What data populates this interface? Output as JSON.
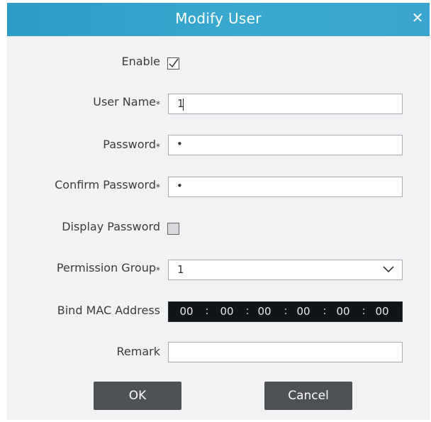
{
  "dialog": {
    "title": "Modify User",
    "close_symbol": "✕",
    "close_icon": "close-icon"
  },
  "form": {
    "enable": {
      "label": "Enable",
      "checked": true
    },
    "user_name": {
      "label": "User Name",
      "required_mark": "*",
      "value": "1"
    },
    "password": {
      "label": "Password",
      "required_mark": "*",
      "value": "•"
    },
    "confirm_password": {
      "label": "Confirm Password",
      "required_mark": "*",
      "value": "•"
    },
    "display_password": {
      "label": "Display Password",
      "checked": false
    },
    "permission_group": {
      "label": "Permission Group",
      "required_mark": "*",
      "selected": "1",
      "icon": "chevron-down-icon"
    },
    "bind_mac": {
      "label": "Bind MAC Address",
      "octets": [
        "00",
        "00",
        "00",
        "00",
        "00",
        "00"
      ],
      "separator": ":"
    },
    "remark": {
      "label": "Remark",
      "value": ""
    }
  },
  "buttons": {
    "ok": "OK",
    "cancel": "Cancel"
  },
  "colors": {
    "titlebar": "#39a9cf",
    "panel": "#f1f2f4",
    "button": "#4e5257",
    "mac_field": "#111418"
  }
}
